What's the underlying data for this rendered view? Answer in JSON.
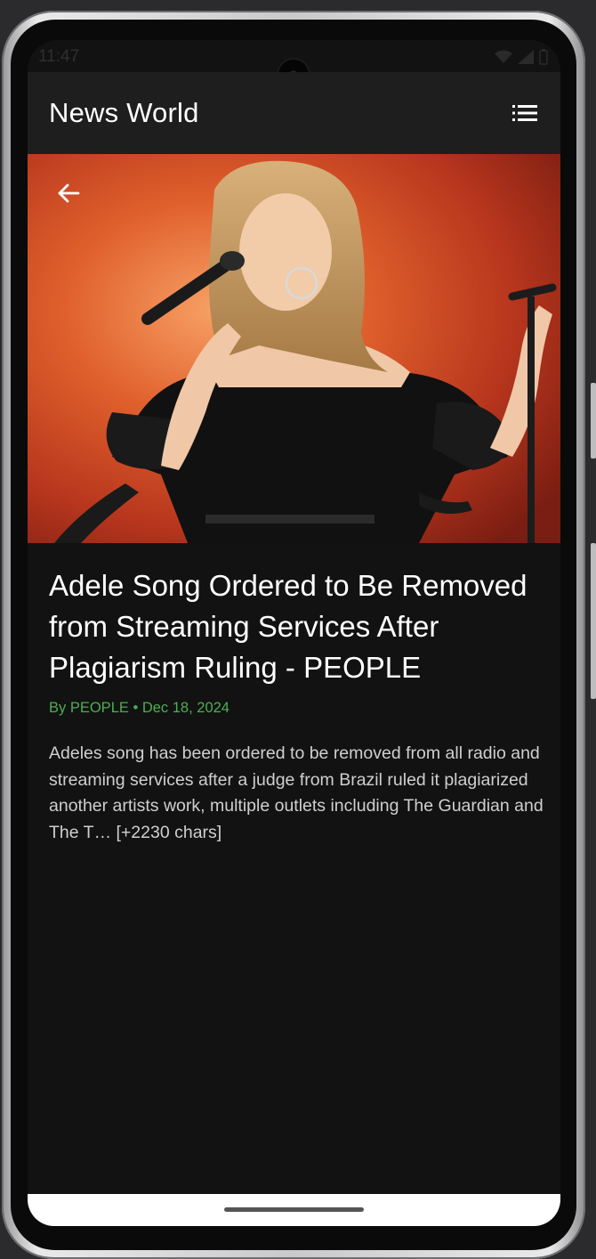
{
  "status_bar": {
    "time": "11:47",
    "icons": [
      "wifi-icon",
      "signal-icon",
      "battery-icon"
    ]
  },
  "app_bar": {
    "title": "News World",
    "menu_icon": "list-icon"
  },
  "article": {
    "back_icon": "arrow-left-icon",
    "image_alt": "Adele performing on stage with microphone",
    "headline": "Adele Song Ordered to Be Removed from Streaming Services After Plagiarism Ruling - PEOPLE",
    "byline": "By PEOPLE • Dec 18, 2024",
    "description": "Adeles song has been ordered to be removed from all radio and streaming services after a judge from Brazil ruled it plagiarized another artists work, multiple outlets including The Guardian and The T… [+2230 chars]"
  },
  "colors": {
    "app_bar_bg": "#1e1e1e",
    "screen_bg": "#121212",
    "byline": "#4caf50",
    "headline": "#ffffff",
    "description": "#cfcfcf"
  }
}
